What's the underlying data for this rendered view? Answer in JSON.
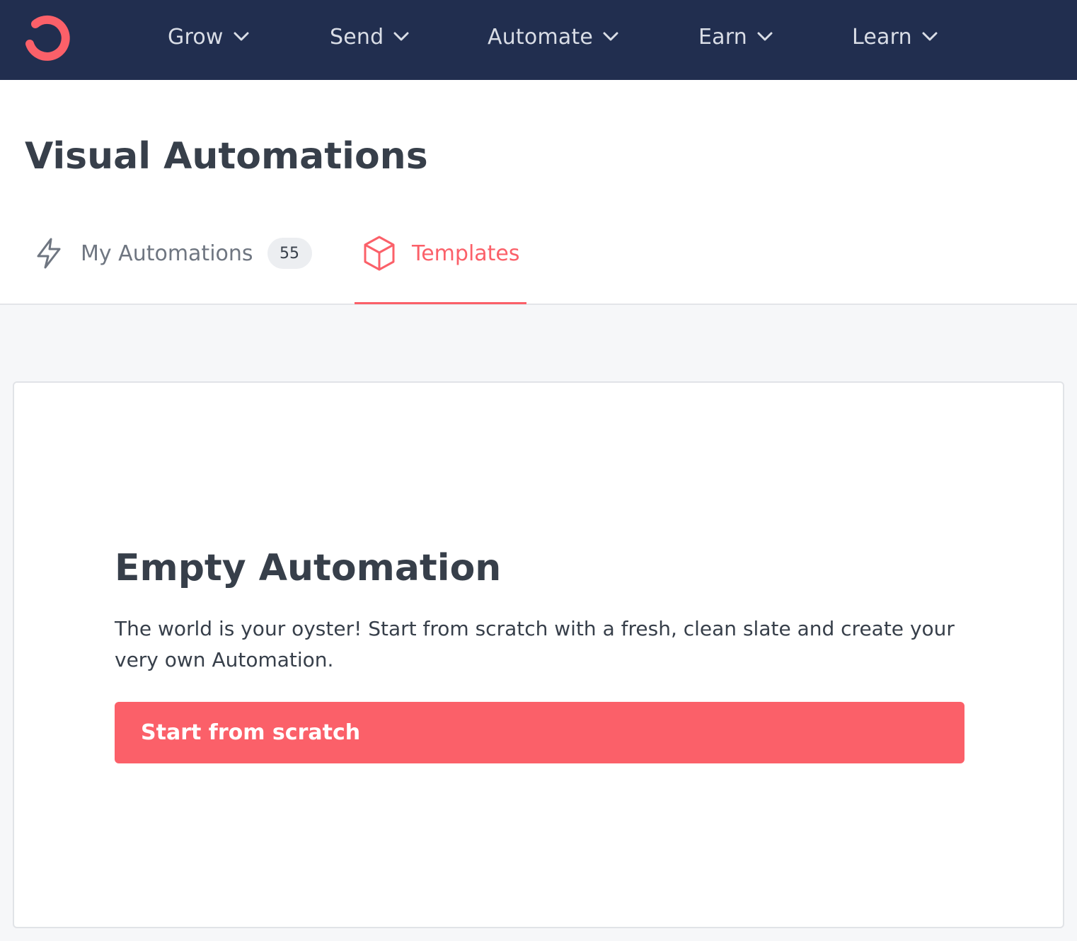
{
  "colors": {
    "nav_background": "#212e4f",
    "accent": "#fb6069",
    "text_dark": "#373f4a",
    "text_muted": "#6f7681",
    "page_background": "#f6f7f9"
  },
  "brand": {
    "logo_icon": "convertkit-logo-icon"
  },
  "nav": {
    "items": [
      {
        "label": "Grow",
        "icon": "chevron-down-icon"
      },
      {
        "label": "Send",
        "icon": "chevron-down-icon"
      },
      {
        "label": "Automate",
        "icon": "chevron-down-icon"
      },
      {
        "label": "Earn",
        "icon": "chevron-down-icon"
      },
      {
        "label": "Learn",
        "icon": "chevron-down-icon"
      }
    ]
  },
  "page": {
    "title": "Visual Automations"
  },
  "tabs": {
    "my_automations": {
      "label": "My Automations",
      "count": "55",
      "icon": "lightning-icon"
    },
    "templates": {
      "label": "Templates",
      "icon": "cube-icon",
      "active": true
    }
  },
  "empty_card": {
    "title": "Empty Automation",
    "description": "The world is your oyster! Start from scratch with a fresh, clean slate and create your very own Automation.",
    "button_label": "Start from scratch"
  }
}
